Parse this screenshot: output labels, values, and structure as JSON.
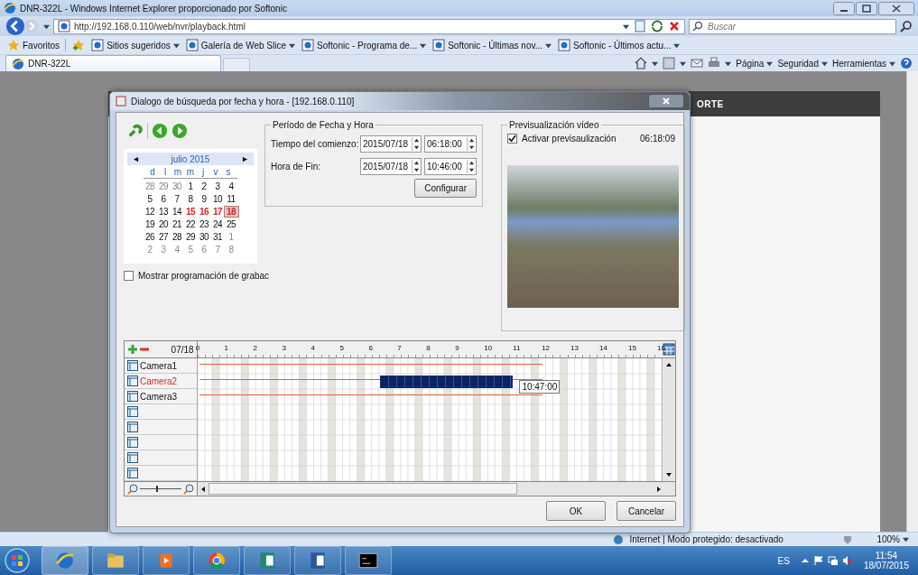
{
  "window": {
    "title": "DNR-322L - Windows Internet Explorer proporcionado por Softonic"
  },
  "address_bar": {
    "url": "http://192.168.0.110/web/nvr/playback.html"
  },
  "search": {
    "placeholder": "Buscar"
  },
  "favorites_bar": {
    "label": "Favoritos",
    "links": [
      "Sitios sugeridos",
      "Galería de Web Slice",
      "Softonic - Programa de...",
      "Softonic - Últimas nov...",
      "Softonic - Últimos actu..."
    ]
  },
  "tab": {
    "label": "DNR-322L"
  },
  "command_bar": [
    "Página",
    "Seguridad",
    "Herramientas"
  ],
  "page": {
    "nav_item": "ORTE"
  },
  "dialog": {
    "title": "Dialogo de búsqueda por fecha y hora - [192.168.0.110]",
    "calendar": {
      "month": "julio 2015",
      "weekdays": [
        "d",
        "l",
        "m",
        "m",
        "j",
        "v",
        "s"
      ],
      "weeks": [
        [
          {
            "day": "28",
            "kind": "other",
            "selected": false
          },
          {
            "day": "29",
            "kind": "other",
            "selected": false
          },
          {
            "day": "30",
            "kind": "other",
            "selected": false
          },
          {
            "day": "1",
            "kind": "normal",
            "selected": false
          },
          {
            "day": "2",
            "kind": "normal",
            "selected": false
          },
          {
            "day": "3",
            "kind": "normal",
            "selected": false
          },
          {
            "day": "4",
            "kind": "normal",
            "selected": false
          }
        ],
        [
          {
            "day": "5",
            "kind": "normal",
            "selected": false
          },
          {
            "day": "6",
            "kind": "normal",
            "selected": false
          },
          {
            "day": "7",
            "kind": "normal",
            "selected": false
          },
          {
            "day": "8",
            "kind": "normal",
            "selected": false
          },
          {
            "day": "9",
            "kind": "normal",
            "selected": false
          },
          {
            "day": "10",
            "kind": "normal",
            "selected": false
          },
          {
            "day": "11",
            "kind": "normal",
            "selected": false
          }
        ],
        [
          {
            "day": "12",
            "kind": "normal",
            "selected": false
          },
          {
            "day": "13",
            "kind": "normal",
            "selected": false
          },
          {
            "day": "14",
            "kind": "normal",
            "selected": false
          },
          {
            "day": "15",
            "kind": "recorded",
            "selected": false
          },
          {
            "day": "16",
            "kind": "recorded",
            "selected": false
          },
          {
            "day": "17",
            "kind": "recorded",
            "selected": false
          },
          {
            "day": "18",
            "kind": "recorded",
            "selected": true
          }
        ],
        [
          {
            "day": "19",
            "kind": "normal",
            "selected": false
          },
          {
            "day": "20",
            "kind": "normal",
            "selected": false
          },
          {
            "day": "21",
            "kind": "normal",
            "selected": false
          },
          {
            "day": "22",
            "kind": "normal",
            "selected": false
          },
          {
            "day": "23",
            "kind": "normal",
            "selected": false
          },
          {
            "day": "24",
            "kind": "normal",
            "selected": false
          },
          {
            "day": "25",
            "kind": "normal",
            "selected": false
          }
        ],
        [
          {
            "day": "26",
            "kind": "normal",
            "selected": false
          },
          {
            "day": "27",
            "kind": "normal",
            "selected": false
          },
          {
            "day": "28",
            "kind": "normal",
            "selected": false
          },
          {
            "day": "29",
            "kind": "normal",
            "selected": false
          },
          {
            "day": "30",
            "kind": "normal",
            "selected": false
          },
          {
            "day": "31",
            "kind": "normal",
            "selected": false
          },
          {
            "day": "1",
            "kind": "other",
            "selected": false
          }
        ],
        [
          {
            "day": "2",
            "kind": "other",
            "selected": false
          },
          {
            "day": "3",
            "kind": "other",
            "selected": false
          },
          {
            "day": "4",
            "kind": "other",
            "selected": false
          },
          {
            "day": "5",
            "kind": "other",
            "selected": false
          },
          {
            "day": "6",
            "kind": "other",
            "selected": false
          },
          {
            "day": "7",
            "kind": "other",
            "selected": false
          },
          {
            "day": "8",
            "kind": "other",
            "selected": false
          }
        ]
      ]
    },
    "show_schedule": {
      "label": "Mostrar programación de grabac",
      "checked": false
    },
    "period": {
      "legend": "Período de Fecha y Hora",
      "rows": [
        {
          "label": "Tiempo del comienzo:",
          "date": "2015/07/18",
          "time": "06:18:00"
        },
        {
          "label": "Hora de Fin:",
          "date": "2015/07/18",
          "time": "10:46:00"
        }
      ],
      "button": "Configurar"
    },
    "preview": {
      "legend": "Previsualización vídeo",
      "enable": {
        "label": "Activar previsaulización",
        "checked": true
      },
      "time": "06:18:09"
    },
    "timeline": {
      "date": "07/18",
      "hours": [
        "0",
        "1",
        "2",
        "3",
        "4",
        "5",
        "6",
        "7",
        "8",
        "9",
        "10",
        "11",
        "12",
        "13",
        "14",
        "15",
        "16"
      ],
      "cameras": [
        {
          "name": "Camera1",
          "selected": false
        },
        {
          "name": "Camera2",
          "selected": true
        },
        {
          "name": "Camera3",
          "selected": false
        }
      ],
      "tooltip": "10:47:00",
      "zoom_slider": {
        "level": 0.4
      }
    },
    "buttons": [
      "OK",
      "Cancelar"
    ]
  },
  "status_bar": {
    "zone": "Internet | Modo protegido: desactivado",
    "zoom": "100%"
  },
  "taskbar": {
    "language": "ES",
    "time": "11:54",
    "date": "18/07/2015"
  }
}
